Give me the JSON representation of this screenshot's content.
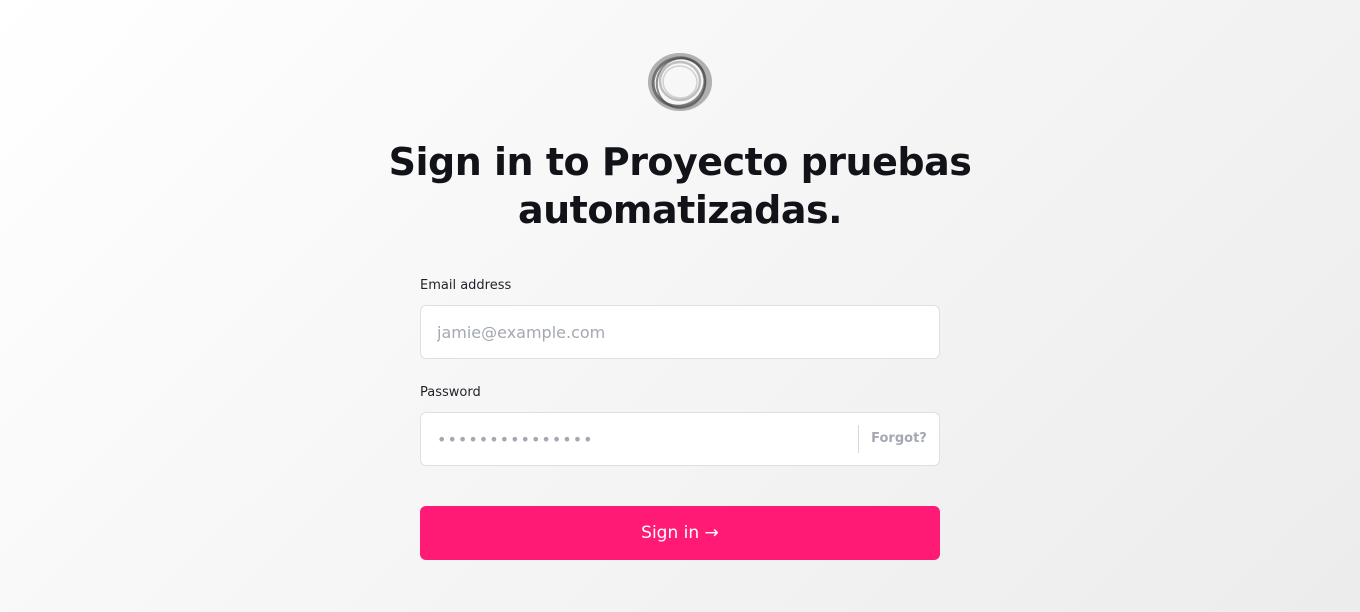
{
  "page": {
    "title": "Sign in to Proyecto pruebas automatizadas.",
    "logo_icon": "ring-logo-icon"
  },
  "form": {
    "email_label": "Email address",
    "email_placeholder": "jamie@example.com",
    "email_value": "",
    "password_label": "Password",
    "password_placeholder": "•••••••••••••••",
    "password_value": "",
    "forgot_label": "Forgot?",
    "submit_label": "Sign in →"
  },
  "colors": {
    "accent": "#ff1a75",
    "text": "#111318",
    "muted": "#a3a8b1",
    "border": "#dcdfe4"
  }
}
